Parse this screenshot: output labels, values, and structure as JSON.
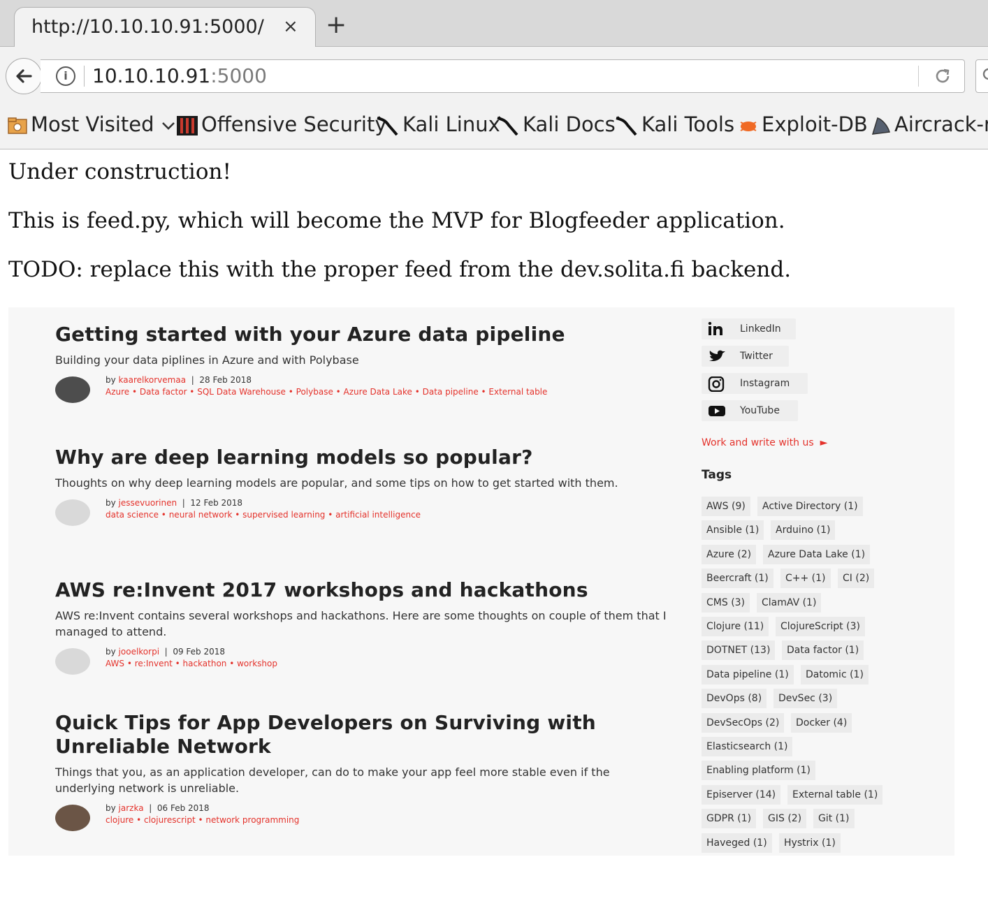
{
  "browser": {
    "tab_title": "http://10.10.10.91:5000/",
    "tab_close": "×",
    "new_tab": "+",
    "url_host": "10.10.10.91",
    "url_port": ":5000",
    "bookmarks": [
      {
        "label": "Most Visited",
        "icon": "folder-star-icon"
      },
      {
        "label": "Offensive Security",
        "icon": "offsec-icon"
      },
      {
        "label": "Kali Linux",
        "icon": "kali-dragon-icon"
      },
      {
        "label": "Kali Docs",
        "icon": "kali-dragon-icon"
      },
      {
        "label": "Kali Tools",
        "icon": "kali-dragon-icon"
      },
      {
        "label": "Exploit-DB",
        "icon": "exploitdb-bug-icon"
      },
      {
        "label": "Aircrack-ng",
        "icon": "aircrack-icon"
      }
    ]
  },
  "page": {
    "line1": "Under construction!",
    "line2": "This is feed.py, which will become the MVP for Blogfeeder application.",
    "line3": "TODO: replace this with the proper feed from the dev.solita.fi backend."
  },
  "blog": {
    "posts": [
      {
        "title": "Getting started with your Azure data pipeline",
        "summary": "Building your data piplines in Azure and with Polybase",
        "by": "by",
        "author": "kaarelkorvemaa",
        "date": "28 Feb 2018",
        "tags_text": "Azure • Data factor • SQL Data Warehouse • Polybase • Azure Data Lake • Data pipeline • External table"
      },
      {
        "title": "Why are deep learning models so popular?",
        "summary": "Thoughts on why deep learning models are popular, and some tips on how to get started with them.",
        "by": "by",
        "author": "jessevuorinen",
        "date": "12 Feb 2018",
        "tags_text": "data science • neural network • supervised learning • artificial intelligence"
      },
      {
        "title": "AWS re:Invent 2017 workshops and hackathons",
        "summary": "AWS re:Invent contains several workshops and hackathons. Here are some thoughts on couple of them that I managed to attend.",
        "by": "by",
        "author": "jooelkorpi",
        "date": "09 Feb 2018",
        "tags_text": "AWS • re:Invent • hackathon • workshop"
      },
      {
        "title": "Quick Tips for App Developers on Surviving with Unreliable Network",
        "summary": "Things that you, as an application developer, can do to make your app feel more stable even if the underlying network is unreliable.",
        "by": "by",
        "author": "jarzka",
        "date": "06 Feb 2018",
        "tags_text": "clojure • clojurescript • network programming"
      }
    ],
    "social": [
      {
        "label": "LinkedIn",
        "icon": "linkedin-icon"
      },
      {
        "label": "Twitter",
        "icon": "twitter-icon"
      },
      {
        "label": "Instagram",
        "icon": "instagram-icon"
      },
      {
        "label": "YouTube",
        "icon": "youtube-icon"
      }
    ],
    "work_link": "Work and write with us",
    "tags_heading": "Tags",
    "tags": [
      [
        "AWS (9)",
        "Active Directory (1)"
      ],
      [
        "Ansible (1)",
        "Arduino (1)"
      ],
      [
        "Azure (2)",
        "Azure Data Lake (1)"
      ],
      [
        "Beercraft (1)",
        "C++ (1)",
        "CI (2)"
      ],
      [
        "CMS (3)",
        "ClamAV (1)"
      ],
      [
        "Clojure (11)",
        "ClojureScript (3)"
      ],
      [
        "DOTNET (13)",
        "Data factor (1)"
      ],
      [
        "Data pipeline (1)",
        "Datomic (1)"
      ],
      [
        "DevOps (8)",
        "DevSec (3)"
      ],
      [
        "DevSecOps (2)",
        "Docker (4)"
      ],
      [
        "Elasticsearch (1)"
      ],
      [
        "Enabling platform (1)"
      ],
      [
        "Episerver (14)",
        "External table (1)"
      ],
      [
        "GDPR (1)",
        "GIS (2)",
        "Git (1)"
      ],
      [
        "Haveged (1)",
        "Hystrix (1)"
      ]
    ],
    "accent_color": "#e4322b"
  }
}
